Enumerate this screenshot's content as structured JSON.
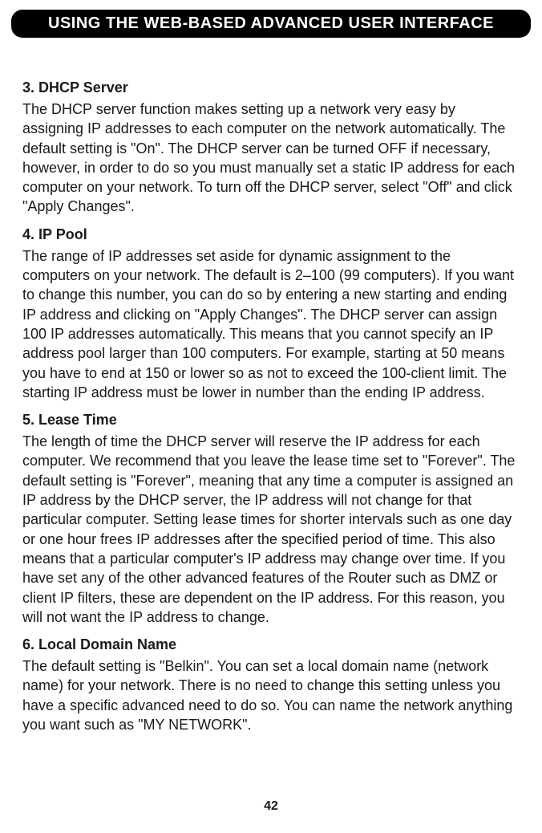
{
  "header": {
    "title": "USING THE WEB-BASED ADVANCED USER INTERFACE"
  },
  "sections": [
    {
      "heading": "3. DHCP Server",
      "body": "The DHCP server function makes setting up a network very easy by assigning IP addresses to each computer on the network automatically. The default setting is \"On\". The DHCP server can be turned OFF if necessary, however, in order to do so you must manually set a static IP address for each computer on your network. To turn off the DHCP server, select \"Off\" and click \"Apply Changes\"."
    },
    {
      "heading": "4. IP Pool",
      "body": "The range of IP addresses set aside for dynamic assignment to the computers on your network. The default is 2–100 (99 computers). If you want to change this number, you can do so by entering a new starting and ending IP address and clicking on \"Apply Changes\". The DHCP server can assign 100 IP addresses automatically. This means that you cannot specify an IP address pool larger than 100 computers. For example, starting at 50 means you have to end at 150 or lower so as not to exceed the 100-client limit. The starting IP address must be lower in number than the ending IP address."
    },
    {
      "heading": "5. Lease Time",
      "body": "The length of time the DHCP server will reserve the IP address for each computer. We recommend that you leave the lease time set to \"Forever\". The default setting is \"Forever\", meaning that any time a computer is assigned an IP address by the DHCP server, the IP address will not change for that particular computer. Setting lease times for shorter intervals such as one day or one hour frees IP addresses after the specified period of time. This also means that a particular computer's IP address may change over time. If you have set any of the other advanced features of the Router such as DMZ or client IP filters, these are dependent on the IP address. For this reason, you will not want the IP address to change."
    },
    {
      "heading": "6. Local Domain Name",
      "body": "The default setting is \"Belkin\". You can set a local domain name (network name) for your network. There is no need to change this setting unless you have a specific advanced need to do so. You can name the network anything you want such as \"MY NETWORK\"."
    }
  ],
  "page_number": "42"
}
